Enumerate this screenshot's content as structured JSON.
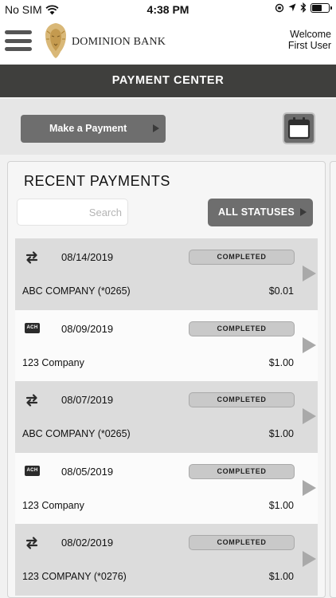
{
  "status_bar": {
    "carrier": "No SIM",
    "time": "4:38 PM",
    "icons": [
      "wifi-icon",
      "orientation-lock-icon",
      "location-icon",
      "bluetooth-icon",
      "battery-icon"
    ]
  },
  "header": {
    "bank_name": "DOMINION BANK",
    "logo_icon": "lion-icon",
    "welcome_line1": "Welcome",
    "welcome_line2": "First User",
    "menu_icon": "hamburger-menu-icon"
  },
  "title": "PAYMENT CENTER",
  "toolbar": {
    "make_payment_label": "Make a Payment",
    "calendar_icon": "calendar-icon"
  },
  "recent": {
    "title": "RECENT PAYMENTS",
    "search_placeholder": "Search",
    "filter_label": "ALL STATUSES"
  },
  "payments": [
    {
      "type": "transfer",
      "date": "08/14/2019",
      "status": "COMPLETED",
      "payee": "ABC COMPANY (*0265)",
      "amount": "$0.01"
    },
    {
      "type": "ach",
      "type_label": "ACH",
      "date": "08/09/2019",
      "status": "COMPLETED",
      "payee": "123 Company",
      "amount": "$1.00"
    },
    {
      "type": "transfer",
      "date": "08/07/2019",
      "status": "COMPLETED",
      "payee": "ABC COMPANY (*0265)",
      "amount": "$1.00"
    },
    {
      "type": "ach",
      "type_label": "ACH",
      "date": "08/05/2019",
      "status": "COMPLETED",
      "payee": "123 Company",
      "amount": "$1.00"
    },
    {
      "type": "transfer",
      "date": "08/02/2019",
      "status": "COMPLETED",
      "payee": "123 COMPANY (*0276)",
      "amount": "$1.00"
    }
  ],
  "colors": {
    "title_bar": "#3f3f3d",
    "button": "#6e6e6e",
    "row_shaded": "#dcdcdc",
    "status_pill": "#c9c9c9"
  }
}
